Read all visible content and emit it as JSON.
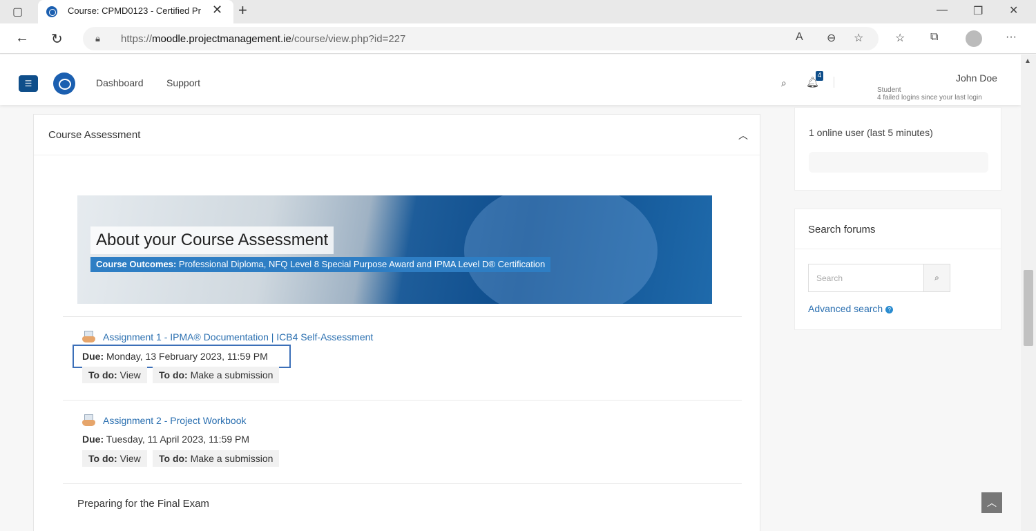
{
  "browser": {
    "tab_title": "Course: CPMD0123 - Certified Pr",
    "tab_close": "✕",
    "new_tab": "+",
    "url_prefix": "https://",
    "url_domain": "moodle.projectmanagement.ie",
    "url_path": "/course/view.php?id=227",
    "icons": [
      "tab-overview-icon",
      "back-icon",
      "refresh-icon",
      "lock-icon",
      "read-aloud-icon",
      "zoom-icon",
      "add-favorite-icon",
      "favorites-icon",
      "collections-icon",
      "profile-icon",
      "more-icon",
      "minimize-icon",
      "maximize-icon",
      "close-window-icon"
    ]
  },
  "navbar": {
    "links": [
      "Dashboard",
      "Support"
    ],
    "notification_count": "4",
    "user_name": "John Doe",
    "user_role": "Student",
    "user_warning": "4 failed logins since your last login"
  },
  "section": {
    "title": "Course Assessment",
    "banner_title": "About your Course Assessment",
    "banner_sub_label": "Course Outcomes:",
    "banner_sub_text": " Professional Diploma, NFQ Level 8 Special Purpose Award and IPMA Level D® Certification",
    "activities": [
      {
        "name": "Assignment 1 - IPMA® Documentation | ICB4 Self-Assessment",
        "due_label": "Due:",
        "due_text": " Monday, 13 February 2023, 11:59 PM",
        "todo1_label": "To do:",
        "todo1_text": " View",
        "todo2_label": "To do:",
        "todo2_text": " Make a submission"
      },
      {
        "name": "Assignment 2 - Project Workbook",
        "due_label": "Due:",
        "due_text": " Tuesday, 11 April 2023, 11:59 PM",
        "todo1_label": "To do:",
        "todo1_text": " View",
        "todo2_label": "To do:",
        "todo2_text": " Make a submission"
      }
    ],
    "subheading": "Preparing for the Final Exam"
  },
  "sidebar": {
    "online_users": "1 online user (last 5 minutes)",
    "search_forums_title": "Search forums",
    "search_placeholder": "Search",
    "advanced_search": "Advanced search"
  },
  "colors": {
    "brand": "#0f4e8a",
    "link": "#2a6fb0",
    "highlight": "#3b6fb8"
  }
}
